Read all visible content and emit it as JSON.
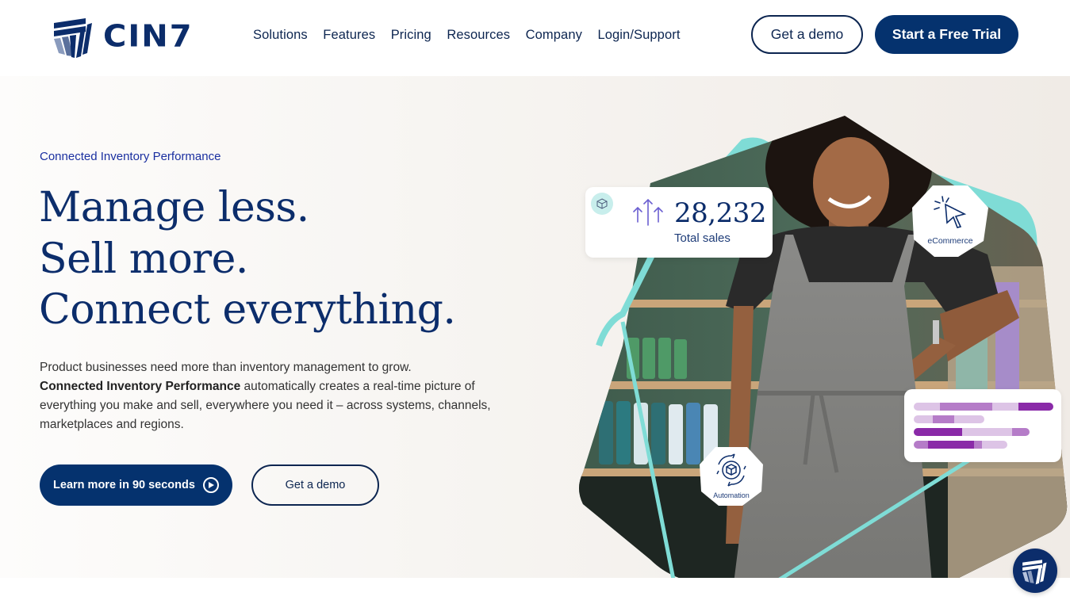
{
  "brand": {
    "name": "CIN7",
    "logo_icon": "cin7-logo-mark-icon",
    "colors": {
      "navy": "#05326e",
      "text_navy": "#0c2d6b",
      "eyebrow_blue": "#1a2fa0",
      "teal": "#7fdcd6",
      "purple_dark": "#8a2aa8",
      "purple_mid": "#b57cc8",
      "purple_light": "#ddc4e6",
      "hero_bg": "#f0ebe6"
    }
  },
  "nav": {
    "items": [
      {
        "label": "Solutions"
      },
      {
        "label": "Features"
      },
      {
        "label": "Pricing"
      },
      {
        "label": "Resources"
      },
      {
        "label": "Company"
      },
      {
        "label": "Login/Support"
      }
    ],
    "demo_button": "Get a demo",
    "trial_button": "Start a Free Trial"
  },
  "hero": {
    "eyebrow": "Connected Inventory Performance",
    "headline": [
      "Manage less.",
      "Sell more.",
      "Connect everything."
    ],
    "description": {
      "line1": "Product businesses need more than inventory management to grow.",
      "bold": "Connected Inventory Performance",
      "rest": " automatically creates a real-time picture of everything you make and sell, everywhere you need it – across systems, channels, marketplaces and regions."
    },
    "video_button": "Learn more in 90 seconds",
    "video_icon": "play-circle-icon",
    "demo_button": "Get a demo"
  },
  "visual": {
    "image_alt": "Smiling retail worker in a grey apron leaning on a store shelf",
    "sales_card": {
      "icon": "cube-icon",
      "trend_icon": "up-arrows-icon",
      "value": "28,232",
      "label": "Total sales"
    },
    "ecommerce_badge": {
      "icon": "cursor-click-icon",
      "label": "eCommerce"
    },
    "automation_badge": {
      "icon": "gear-cube-cycle-icon",
      "label": "Automation"
    },
    "bar_card": {
      "rows": [
        {
          "segments": [
            {
              "share": 0.19,
              "tone": "light"
            },
            {
              "share": 0.37,
              "tone": "mid"
            },
            {
              "share": 0.19,
              "tone": "light"
            },
            {
              "share": 0.25,
              "tone": "dark"
            }
          ]
        },
        {
          "segments": [
            {
              "share": 0.27,
              "tone": "light"
            },
            {
              "share": 0.3,
              "tone": "mid"
            },
            {
              "share": 0.43,
              "tone": "light"
            }
          ]
        },
        {
          "segments": [
            {
              "share": 0.42,
              "tone": "dark"
            },
            {
              "share": 0.31,
              "tone": "light"
            },
            {
              "share": 0.12,
              "tone": "light"
            },
            {
              "share": 0.15,
              "tone": "mid"
            }
          ]
        },
        {
          "segments": [
            {
              "share": 0.15,
              "tone": "mid"
            },
            {
              "share": 0.49,
              "tone": "dark"
            },
            {
              "share": 0.09,
              "tone": "mid"
            },
            {
              "share": 0.27,
              "tone": "light"
            }
          ]
        }
      ]
    }
  },
  "chat_widget": {
    "icon": "cin7-chat-icon"
  }
}
